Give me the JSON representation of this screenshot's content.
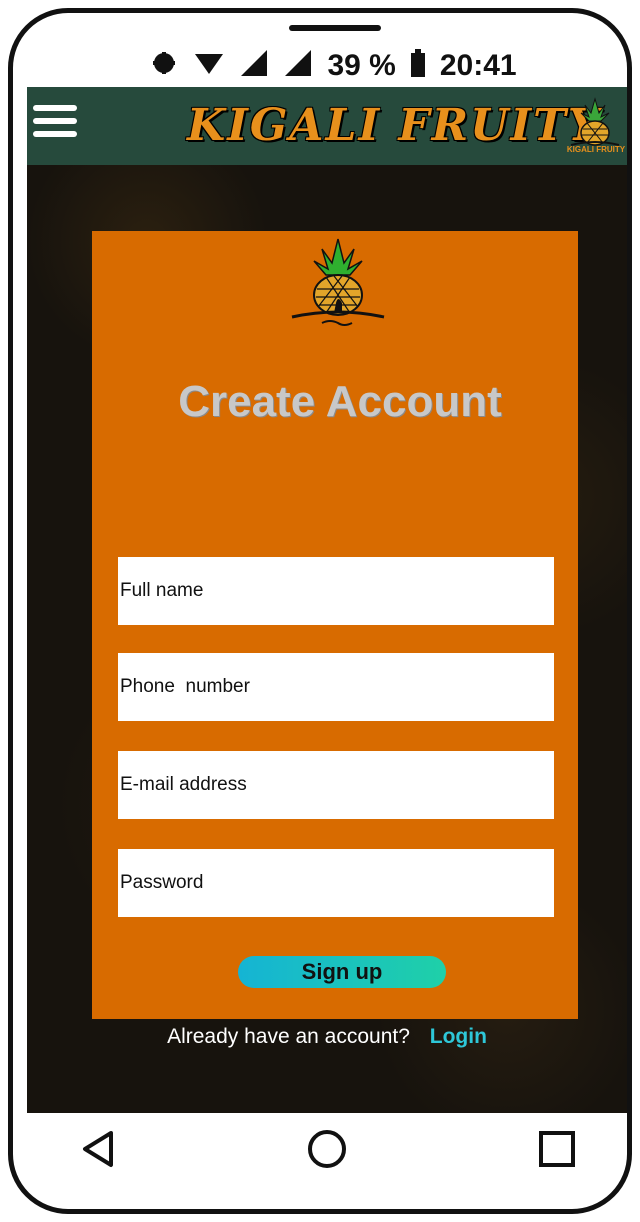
{
  "status_bar": {
    "icons": [
      "notification-icon",
      "wifi-icon",
      "signal-icon",
      "signal-icon",
      "battery-icon"
    ],
    "battery_percent": "39 %",
    "time": "20:41"
  },
  "header": {
    "brand_title": "KIGALI FRUITY",
    "logo_text": "KIGALI FRUITY",
    "colors": {
      "header_bg": "#264a3c",
      "brand": "#e8901c"
    }
  },
  "signup": {
    "title": "Create Account",
    "fields": {
      "full_name": "Full name",
      "phone": "Phone  number",
      "email": "E-mail address",
      "password": "Password"
    },
    "button_label": "Sign up",
    "login_prompt": "Already have an account?",
    "login_link": "Login",
    "colors": {
      "card_bg": "#d86b00",
      "button_start": "#15b4d4",
      "button_end": "#1fd0a8",
      "link": "#2ec7d8"
    }
  },
  "nav": {
    "back": "back-icon",
    "home": "home-icon",
    "recents": "recents-icon"
  }
}
